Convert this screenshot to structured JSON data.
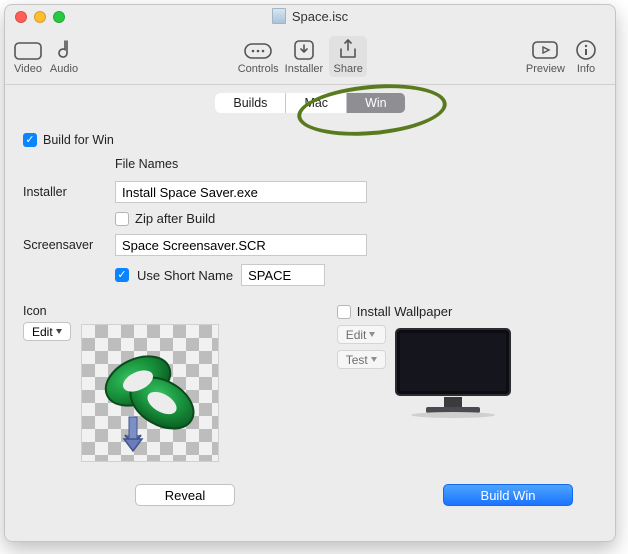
{
  "window": {
    "title": "Space.isc"
  },
  "toolbar": {
    "video": "Video",
    "audio": "Audio",
    "controls": "Controls",
    "installer": "Installer",
    "share": "Share",
    "preview": "Preview",
    "info": "Info"
  },
  "seg": {
    "builds": "Builds",
    "mac": "Mac",
    "win": "Win",
    "active": "win"
  },
  "buildfor": {
    "label": "Build for Win",
    "checked": true
  },
  "filenames_header": "File Names",
  "installer": {
    "label": "Installer",
    "value": "Install Space Saver.exe",
    "zip_label": "Zip after Build",
    "zip_checked": false
  },
  "screensaver": {
    "label": "Screensaver",
    "value": "Space Screensaver.SCR",
    "shortname_label": "Use Short Name",
    "shortname_checked": true,
    "shortname_value": "SPACE"
  },
  "icon": {
    "label": "Icon",
    "edit": "Edit"
  },
  "wallpaper": {
    "install_label": "Install Wallpaper",
    "install_checked": false,
    "edit": "Edit",
    "test": "Test"
  },
  "buttons": {
    "reveal": "Reveal",
    "build": "Build Win"
  }
}
